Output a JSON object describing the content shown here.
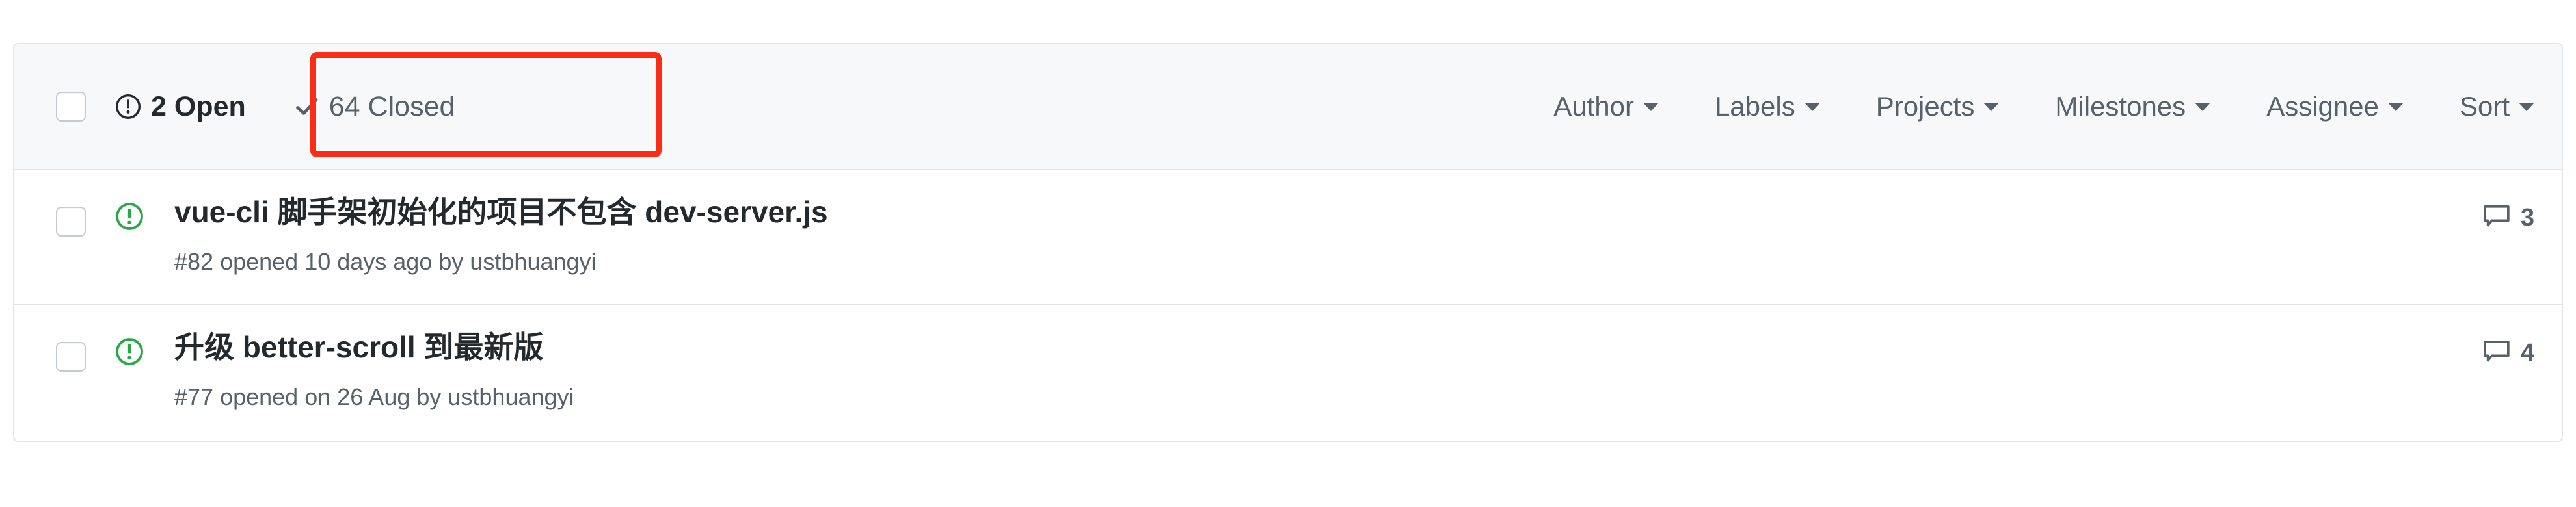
{
  "colors": {
    "header_bg": "#f6f8fa",
    "border": "#e1e4e8",
    "text_primary": "#24292e",
    "text_muted": "#586069",
    "open_green": "#28a745",
    "annotation_red": "#fa2d16"
  },
  "header": {
    "select_all_checkbox": "select-all",
    "states": [
      {
        "id": "open",
        "icon": "issue-opened-icon",
        "count": "2",
        "label": "Open",
        "text": "2 Open",
        "active": true
      },
      {
        "id": "closed",
        "icon": "check-icon",
        "count": "64",
        "label": "Closed",
        "text": "64 Closed",
        "active": false
      }
    ],
    "filters": [
      {
        "label": "Author",
        "icon": "chevron-down-icon"
      },
      {
        "label": "Labels",
        "icon": "chevron-down-icon"
      },
      {
        "label": "Projects",
        "icon": "chevron-down-icon"
      },
      {
        "label": "Milestones",
        "icon": "chevron-down-icon"
      },
      {
        "label": "Assignee",
        "icon": "chevron-down-icon"
      },
      {
        "label": "Sort",
        "icon": "chevron-down-icon"
      }
    ]
  },
  "annotation": {
    "type": "highlight-rectangle",
    "target": "closed-filter",
    "color": "#fa2d16"
  },
  "issues": [
    {
      "checkbox": "issue-checkbox",
      "state_icon": "issue-opened-icon",
      "title": "vue-cli 脚手架初始化的项目不包含 dev-server.js",
      "meta": "#82 opened 10 days ago by ustbhuangyi",
      "number": "#82",
      "opened_text": "opened 10 days ago",
      "author": "ustbhuangyi",
      "comment_icon": "comment-icon",
      "comments": "3"
    },
    {
      "checkbox": "issue-checkbox",
      "state_icon": "issue-opened-icon",
      "title": "升级 better-scroll 到最新版",
      "meta": "#77 opened on 26 Aug by ustbhuangyi",
      "number": "#77",
      "opened_text": "opened on 26 Aug",
      "author": "ustbhuangyi",
      "comment_icon": "comment-icon",
      "comments": "4"
    }
  ]
}
